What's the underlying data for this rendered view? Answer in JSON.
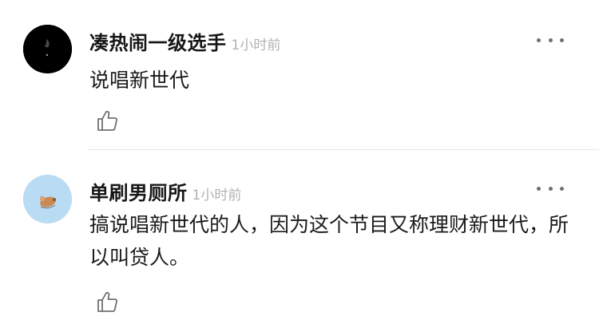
{
  "comments": [
    {
      "username": "凑热闹一级选手",
      "time": "1小时前",
      "content": "说唱新世代",
      "avatar": "dark-night-sky",
      "icons": {
        "more": "more-icon",
        "like": "thumbs-up-icon"
      }
    },
    {
      "username": "单刷男厕所",
      "time": "1小时前",
      "content": "搞说唱新世代的人，因为这个节目又称理财新世代，所以叫贷人。",
      "avatar": "cartoon-on-light-blue",
      "icons": {
        "more": "more-icon",
        "like": "thumbs-up-icon"
      }
    }
  ],
  "colors": {
    "text": "#1a1a1a",
    "timestamp": "#b2b2b2",
    "icon": "#707070",
    "divider": "#e6e6e6",
    "avatar2_bg": "#b9dbf4"
  }
}
